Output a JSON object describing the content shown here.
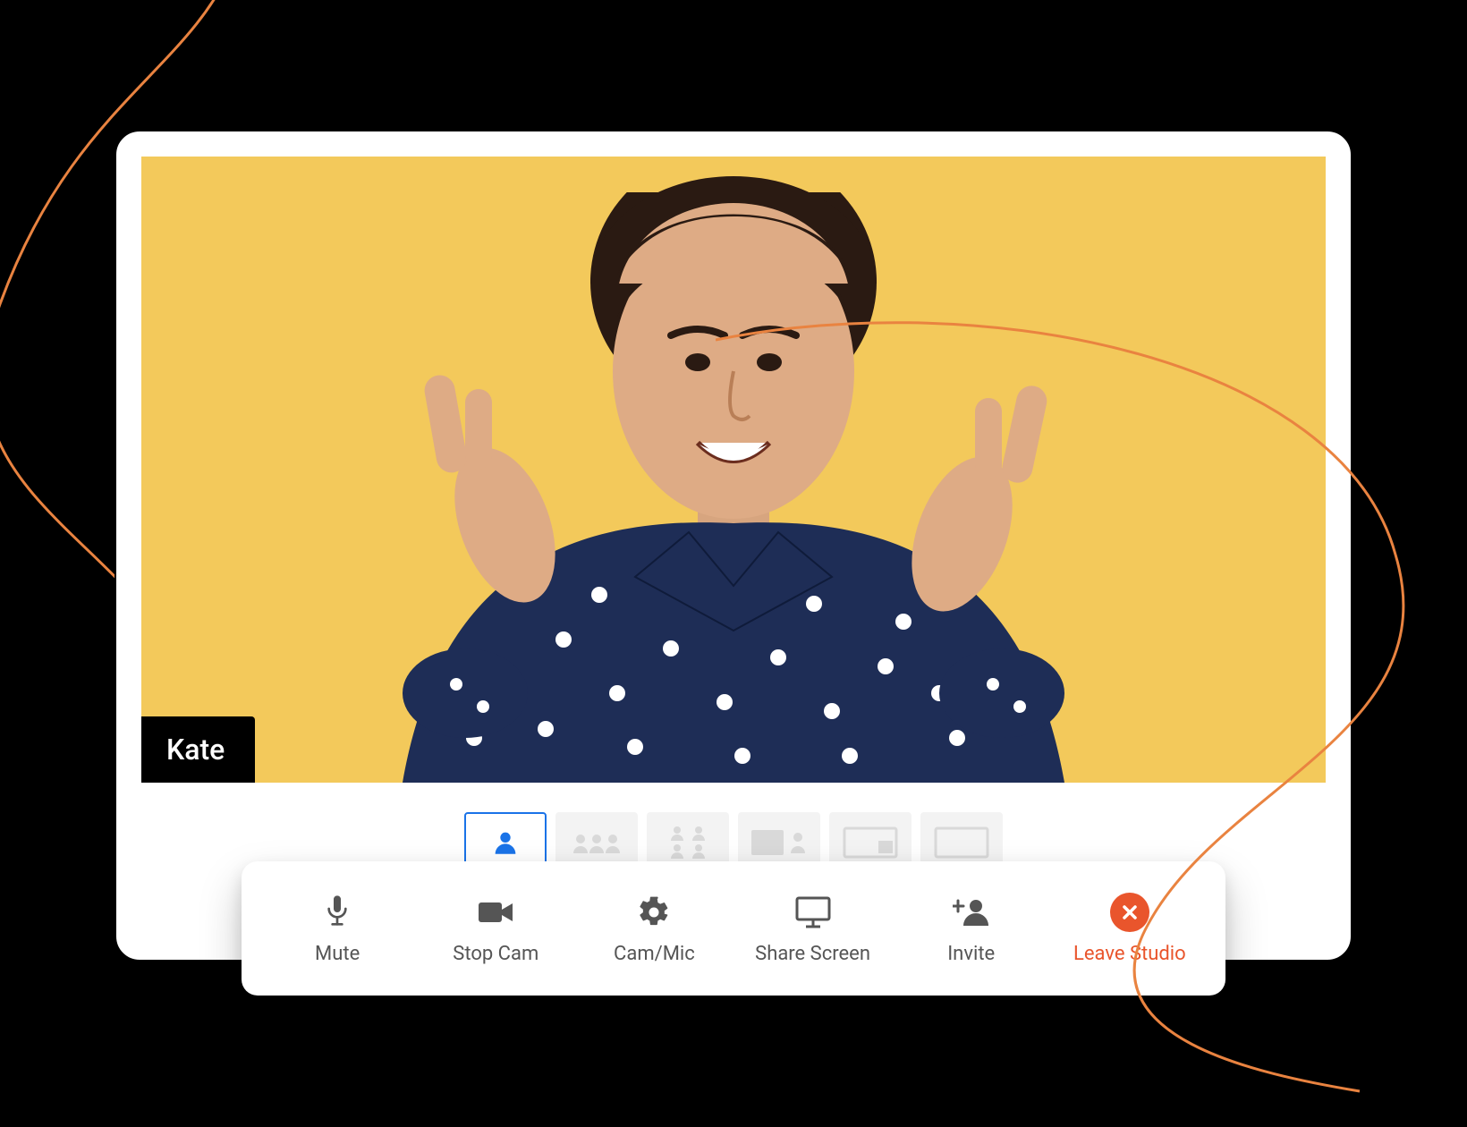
{
  "participant": {
    "name": "Kate"
  },
  "layouts": [
    {
      "id": "single",
      "icon": "single-person",
      "active": true
    },
    {
      "id": "three",
      "icon": "three-people",
      "active": false
    },
    {
      "id": "four",
      "icon": "four-people",
      "active": false
    },
    {
      "id": "presenter-side",
      "icon": "presenter-side",
      "active": false
    },
    {
      "id": "screen-pip",
      "icon": "screen-pip",
      "active": false
    },
    {
      "id": "screen-only",
      "icon": "screen-only",
      "active": false
    }
  ],
  "toolbar": {
    "mute_label": "Mute",
    "stop_cam_label": "Stop Cam",
    "cam_mic_label": "Cam/Mic",
    "share_screen_label": "Share Screen",
    "invite_label": "Invite",
    "leave_label": "Leave Studio"
  },
  "colors": {
    "stage_bg": "#f3c95b",
    "accent_blue": "#1a73e8",
    "leave_red": "#e9552c",
    "squiggle": "#e98340"
  }
}
